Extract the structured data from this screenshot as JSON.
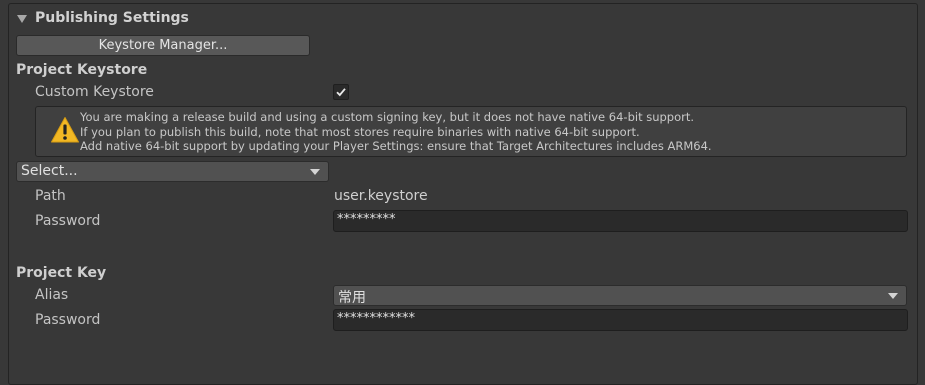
{
  "header": {
    "title": "Publishing Settings"
  },
  "keystore_manager_button": "Keystore Manager...",
  "project_keystore": {
    "title": "Project Keystore",
    "custom_keystore_label": "Custom Keystore",
    "custom_keystore_checked": true,
    "warning_lines": [
      "You are making a release build and using a custom signing key, but it does not have native 64-bit support.",
      "If you plan to publish this build, note that most stores require binaries with native 64-bit support.",
      "Add native 64-bit support by updating your Player Settings: ensure that Target Architectures includes ARM64."
    ],
    "select_dropdown": "Select...",
    "path_label": "Path",
    "path_value": "user.keystore",
    "password_label": "Password",
    "password_value": "*********"
  },
  "project_key": {
    "title": "Project Key",
    "alias_label": "Alias",
    "alias_value": "常用",
    "password_label": "Password",
    "password_value": "************"
  },
  "colors": {
    "background": "#383838",
    "warning": "#f2b824",
    "field": "#2a2a2a"
  }
}
